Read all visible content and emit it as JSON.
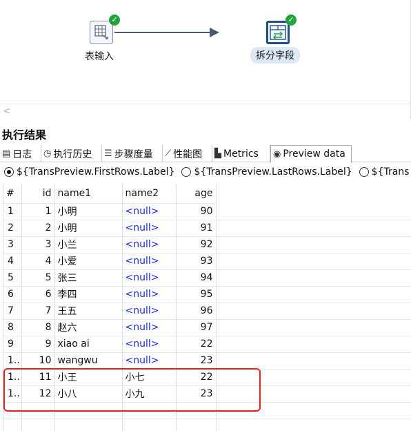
{
  "canvas": {
    "nodes": [
      {
        "label": "表输入",
        "icon": "table-input-icon",
        "status": "success"
      },
      {
        "label": "拆分字段",
        "icon": "split-fields-icon",
        "status": "success"
      }
    ],
    "scroll_left_glyph": "<"
  },
  "results": {
    "title": "执行结果",
    "tabs": [
      {
        "label": "日志",
        "icon": "log-icon"
      },
      {
        "label": "执行历史",
        "icon": "history-icon"
      },
      {
        "label": "步骤度量",
        "icon": "step-metrics-icon"
      },
      {
        "label": "性能图",
        "icon": "performance-graph-icon"
      },
      {
        "label": "Metrics",
        "icon": "metrics-icon"
      },
      {
        "label": "Preview data",
        "icon": "eye-icon",
        "active": true
      }
    ],
    "radios": [
      {
        "label": "${TransPreview.FirstRows.Label}",
        "selected": true
      },
      {
        "label": "${TransPreview.LastRows.Label}",
        "selected": false
      },
      {
        "label": "${Trans",
        "selected": false
      }
    ],
    "columns": [
      "#",
      "id",
      "name1",
      "name2",
      "age"
    ],
    "rows": [
      {
        "num": "1",
        "id": "1",
        "name1": "小明",
        "name2": "<null>",
        "age": "90"
      },
      {
        "num": "2",
        "id": "2",
        "name1": "小明",
        "name2": "<null>",
        "age": "91"
      },
      {
        "num": "3",
        "id": "3",
        "name1": "小兰",
        "name2": "<null>",
        "age": "92"
      },
      {
        "num": "4",
        "id": "4",
        "name1": "小爱",
        "name2": "<null>",
        "age": "93"
      },
      {
        "num": "5",
        "id": "5",
        "name1": "张三",
        "name2": "<null>",
        "age": "94"
      },
      {
        "num": "6",
        "id": "6",
        "name1": "李四",
        "name2": "<null>",
        "age": "95"
      },
      {
        "num": "7",
        "id": "7",
        "name1": "王五",
        "name2": "<null>",
        "age": "96"
      },
      {
        "num": "8",
        "id": "8",
        "name1": "赵六",
        "name2": "<null>",
        "age": "97"
      },
      {
        "num": "9",
        "id": "9",
        "name1": "xiao ai",
        "name2": "<null>",
        "age": "22"
      },
      {
        "num": "1..",
        "id": "10",
        "name1": " wangwu",
        "name2": "<null>",
        "age": "23"
      },
      {
        "num": "1..",
        "id": "11",
        "name1": "小王",
        "name2": "小七",
        "age": "22"
      },
      {
        "num": "1..",
        "id": "12",
        "name1": "小八",
        "name2": "小九",
        "age": "23"
      }
    ]
  },
  "colors": {
    "null_text": "#1b2bd6",
    "highlight": "#e5211c",
    "success": "#22a43a"
  }
}
